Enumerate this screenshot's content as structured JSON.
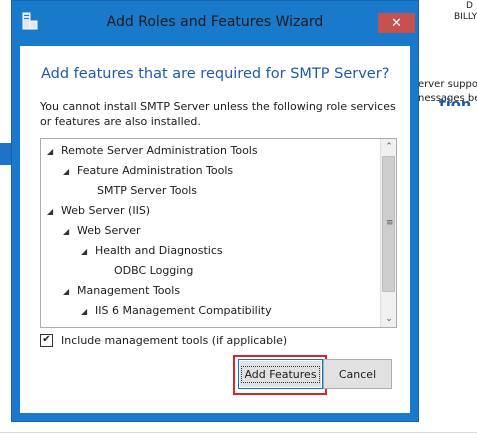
{
  "background": {
    "top_right_line1": "D",
    "top_right_line2": "BILLY",
    "right_heading": "tion",
    "right_line1": "erver suppo",
    "right_line2": "nessages be"
  },
  "dialog": {
    "title": "Add Roles and Features Wizard",
    "close_glyph": "✕",
    "heading": "Add features that are required for SMTP Server?",
    "description": "You cannot install SMTP Server unless the following role services or features are also installed.",
    "tree": [
      {
        "label": "Remote Server Administration Tools",
        "expander": "◢"
      },
      {
        "label": "Feature Administration Tools",
        "expander": "◢"
      },
      {
        "label": "SMTP Server Tools",
        "expander": ""
      },
      {
        "label": "Web Server (IIS)",
        "expander": "◢"
      },
      {
        "label": "Web Server",
        "expander": "◢"
      },
      {
        "label": "Health and Diagnostics",
        "expander": "◢"
      },
      {
        "label": "ODBC Logging",
        "expander": ""
      },
      {
        "label": "Management Tools",
        "expander": "◢"
      },
      {
        "label": "IIS 6 Management Compatibility",
        "expander": "◢"
      }
    ],
    "scroll_up_glyph": "⌃",
    "scroll_down_glyph": "⌄",
    "scroll_grip": "≡",
    "include_tools_label": "Include management tools (if applicable)",
    "include_tools_checked": true,
    "checkmark": "✔",
    "add_features_label": "Add Features",
    "cancel_label": "Cancel"
  },
  "colors": {
    "frame": "#1979ca",
    "heading": "#1e5aa8",
    "close": "#c75050",
    "highlight": "#d42727"
  }
}
